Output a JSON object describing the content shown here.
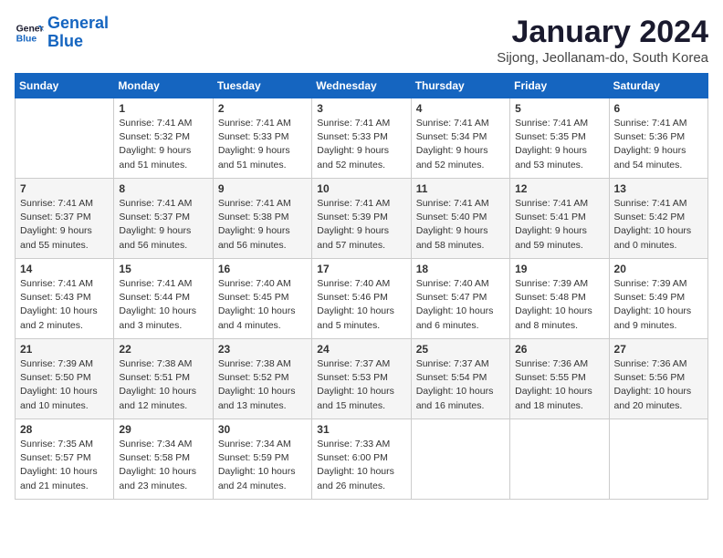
{
  "logo": {
    "line1": "General",
    "line2": "Blue"
  },
  "title": "January 2024",
  "subtitle": "Sijong, Jeollanam-do, South Korea",
  "days_header": [
    "Sunday",
    "Monday",
    "Tuesday",
    "Wednesday",
    "Thursday",
    "Friday",
    "Saturday"
  ],
  "weeks": [
    [
      {
        "day": "",
        "content": ""
      },
      {
        "day": "1",
        "content": "Sunrise: 7:41 AM\nSunset: 5:32 PM\nDaylight: 9 hours\nand 51 minutes."
      },
      {
        "day": "2",
        "content": "Sunrise: 7:41 AM\nSunset: 5:33 PM\nDaylight: 9 hours\nand 51 minutes."
      },
      {
        "day": "3",
        "content": "Sunrise: 7:41 AM\nSunset: 5:33 PM\nDaylight: 9 hours\nand 52 minutes."
      },
      {
        "day": "4",
        "content": "Sunrise: 7:41 AM\nSunset: 5:34 PM\nDaylight: 9 hours\nand 52 minutes."
      },
      {
        "day": "5",
        "content": "Sunrise: 7:41 AM\nSunset: 5:35 PM\nDaylight: 9 hours\nand 53 minutes."
      },
      {
        "day": "6",
        "content": "Sunrise: 7:41 AM\nSunset: 5:36 PM\nDaylight: 9 hours\nand 54 minutes."
      }
    ],
    [
      {
        "day": "7",
        "content": "Sunrise: 7:41 AM\nSunset: 5:37 PM\nDaylight: 9 hours\nand 55 minutes."
      },
      {
        "day": "8",
        "content": "Sunrise: 7:41 AM\nSunset: 5:37 PM\nDaylight: 9 hours\nand 56 minutes."
      },
      {
        "day": "9",
        "content": "Sunrise: 7:41 AM\nSunset: 5:38 PM\nDaylight: 9 hours\nand 56 minutes."
      },
      {
        "day": "10",
        "content": "Sunrise: 7:41 AM\nSunset: 5:39 PM\nDaylight: 9 hours\nand 57 minutes."
      },
      {
        "day": "11",
        "content": "Sunrise: 7:41 AM\nSunset: 5:40 PM\nDaylight: 9 hours\nand 58 minutes."
      },
      {
        "day": "12",
        "content": "Sunrise: 7:41 AM\nSunset: 5:41 PM\nDaylight: 9 hours\nand 59 minutes."
      },
      {
        "day": "13",
        "content": "Sunrise: 7:41 AM\nSunset: 5:42 PM\nDaylight: 10 hours\nand 0 minutes."
      }
    ],
    [
      {
        "day": "14",
        "content": "Sunrise: 7:41 AM\nSunset: 5:43 PM\nDaylight: 10 hours\nand 2 minutes."
      },
      {
        "day": "15",
        "content": "Sunrise: 7:41 AM\nSunset: 5:44 PM\nDaylight: 10 hours\nand 3 minutes."
      },
      {
        "day": "16",
        "content": "Sunrise: 7:40 AM\nSunset: 5:45 PM\nDaylight: 10 hours\nand 4 minutes."
      },
      {
        "day": "17",
        "content": "Sunrise: 7:40 AM\nSunset: 5:46 PM\nDaylight: 10 hours\nand 5 minutes."
      },
      {
        "day": "18",
        "content": "Sunrise: 7:40 AM\nSunset: 5:47 PM\nDaylight: 10 hours\nand 6 minutes."
      },
      {
        "day": "19",
        "content": "Sunrise: 7:39 AM\nSunset: 5:48 PM\nDaylight: 10 hours\nand 8 minutes."
      },
      {
        "day": "20",
        "content": "Sunrise: 7:39 AM\nSunset: 5:49 PM\nDaylight: 10 hours\nand 9 minutes."
      }
    ],
    [
      {
        "day": "21",
        "content": "Sunrise: 7:39 AM\nSunset: 5:50 PM\nDaylight: 10 hours\nand 10 minutes."
      },
      {
        "day": "22",
        "content": "Sunrise: 7:38 AM\nSunset: 5:51 PM\nDaylight: 10 hours\nand 12 minutes."
      },
      {
        "day": "23",
        "content": "Sunrise: 7:38 AM\nSunset: 5:52 PM\nDaylight: 10 hours\nand 13 minutes."
      },
      {
        "day": "24",
        "content": "Sunrise: 7:37 AM\nSunset: 5:53 PM\nDaylight: 10 hours\nand 15 minutes."
      },
      {
        "day": "25",
        "content": "Sunrise: 7:37 AM\nSunset: 5:54 PM\nDaylight: 10 hours\nand 16 minutes."
      },
      {
        "day": "26",
        "content": "Sunrise: 7:36 AM\nSunset: 5:55 PM\nDaylight: 10 hours\nand 18 minutes."
      },
      {
        "day": "27",
        "content": "Sunrise: 7:36 AM\nSunset: 5:56 PM\nDaylight: 10 hours\nand 20 minutes."
      }
    ],
    [
      {
        "day": "28",
        "content": "Sunrise: 7:35 AM\nSunset: 5:57 PM\nDaylight: 10 hours\nand 21 minutes."
      },
      {
        "day": "29",
        "content": "Sunrise: 7:34 AM\nSunset: 5:58 PM\nDaylight: 10 hours\nand 23 minutes."
      },
      {
        "day": "30",
        "content": "Sunrise: 7:34 AM\nSunset: 5:59 PM\nDaylight: 10 hours\nand 24 minutes."
      },
      {
        "day": "31",
        "content": "Sunrise: 7:33 AM\nSunset: 6:00 PM\nDaylight: 10 hours\nand 26 minutes."
      },
      {
        "day": "",
        "content": ""
      },
      {
        "day": "",
        "content": ""
      },
      {
        "day": "",
        "content": ""
      }
    ]
  ]
}
